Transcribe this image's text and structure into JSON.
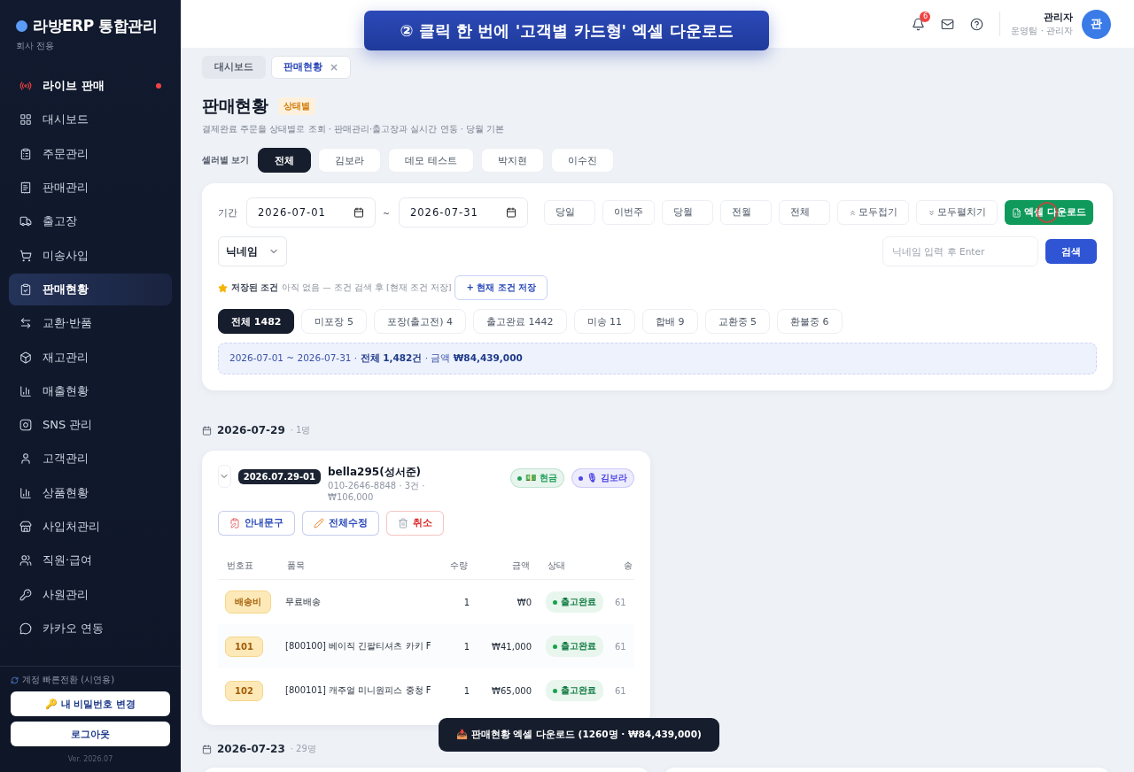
{
  "brand": {
    "title": "라방ERP 통합관리",
    "subtitle": "회사 전용"
  },
  "sidebar": {
    "items": [
      {
        "label": "라이브 판매",
        "selected": false,
        "live": true
      },
      {
        "label": "대시보드",
        "selected": false,
        "live": false
      },
      {
        "label": "주문관리",
        "selected": false,
        "live": false
      },
      {
        "label": "판매관리",
        "selected": false,
        "live": false
      },
      {
        "label": "출고장",
        "selected": false,
        "live": false
      },
      {
        "label": "미송사입",
        "selected": false,
        "live": false
      },
      {
        "label": "판매현황",
        "selected": true,
        "live": false
      },
      {
        "label": "교환·반품",
        "selected": false,
        "live": false
      },
      {
        "label": "재고관리",
        "selected": false,
        "live": false
      },
      {
        "label": "매출현황",
        "selected": false,
        "live": false
      },
      {
        "label": "SNS 관리",
        "selected": false,
        "live": false
      },
      {
        "label": "고객관리",
        "selected": false,
        "live": false
      },
      {
        "label": "상품현황",
        "selected": false,
        "live": false
      },
      {
        "label": "사입처관리",
        "selected": false,
        "live": false
      },
      {
        "label": "직원·급여",
        "selected": false,
        "live": false
      },
      {
        "label": "사원관리",
        "selected": false,
        "live": false
      },
      {
        "label": "카카오 연동",
        "selected": false,
        "live": false
      }
    ],
    "switch_note": "계정 빠른전환 (시연용)",
    "buttons": [
      "🔑 내 비밀번호 변경",
      "로그아웃"
    ],
    "version": "Ver. 2026.07"
  },
  "banner": "② 클릭 한 번에 '고객별 카드형' 엑셀 다운로드",
  "header": {
    "notifications": "6",
    "user_name": "관리자",
    "user_role": "운영팀 · 관리자",
    "avatar": "관"
  },
  "page_tabs": [
    {
      "label": "대시보드",
      "selected": false,
      "closable": false
    },
    {
      "label": "판매현황",
      "selected": true,
      "closable": true
    }
  ],
  "close_mark": "×",
  "page": {
    "title": "판매현황",
    "badge": "상태별",
    "description": "결제완료 주문을 상태별로 조회 · 판매관리·출고장과 실시간 연동 · 당월 기본"
  },
  "seller_filter": {
    "label": "셀러별 보기",
    "options": [
      {
        "label": "전체",
        "selected": true
      },
      {
        "label": "김보라",
        "selected": false
      },
      {
        "label": "데모 테스트",
        "selected": false
      },
      {
        "label": "박지현",
        "selected": false
      },
      {
        "label": "이수진",
        "selected": false
      }
    ]
  },
  "filters": {
    "period_label": "기간",
    "from": "2026-07-01",
    "to": "2026-07-31",
    "tilde": "~",
    "quick": [
      "당일",
      "이번주",
      "당월",
      "전월",
      "전체"
    ],
    "collapse": "모두접기",
    "expand": "모두펼치기",
    "excel": "엑셀 다운로드",
    "search_type": "닉네임",
    "search_placeholder": "닉네임 입력 후 Enter",
    "search_button": "검색",
    "saved_label": "저장된 조건",
    "saved_note": "아직 없음 — 조건 검색 후 [현재 조건 저장]",
    "save_button": "+ 현재 조건 저장",
    "status_tabs": [
      {
        "label": "전체 1482",
        "selected": true
      },
      {
        "label": "미포장 5",
        "selected": false
      },
      {
        "label": "포장(출고전) 4",
        "selected": false
      },
      {
        "label": "출고완료 1442",
        "selected": false
      },
      {
        "label": "미송 11",
        "selected": false
      },
      {
        "label": "합배 9",
        "selected": false
      },
      {
        "label": "교환중 5",
        "selected": false
      },
      {
        "label": "환불중 6",
        "selected": false
      }
    ],
    "summary": "2026-07-01 ~ 2026-07-31 · **전체 1,482건** · 금액 **₩84,439,000**"
  },
  "groups": [
    {
      "date": "2026-07-29",
      "count": "· 1명",
      "orders": [
        {
          "code": "2026.07.29-01",
          "customer": "bella295(성서준)",
          "meta": "010-2646-8848 · 3건 ·",
          "total": "₩106,000",
          "tags": [
            {
              "label": "💵 현금",
              "color": "#22a05a"
            },
            {
              "label": "🎙 김보라",
              "color": "#4f46e5"
            }
          ],
          "actions": [
            {
              "label": "안내문구",
              "kind": "note"
            },
            {
              "label": "전체수정",
              "kind": "edit"
            },
            {
              "label": "취소",
              "kind": "cancel"
            }
          ],
          "columns": [
            "번호표",
            "품목",
            "수량",
            "금액",
            "상태",
            "송"
          ],
          "rows": [
            {
              "ticket": "배송비",
              "item": "무료배송",
              "qty": "1",
              "amount": "₩0",
              "status": "출고완료",
              "column_6": "61"
            },
            {
              "ticket": "101",
              "item": "[800100] 베이직 긴팔티셔츠 카키 F",
              "qty": "1",
              "amount": "₩41,000",
              "status": "출고완료",
              "column_6": "61"
            },
            {
              "ticket": "102",
              "item": "[800101] 캐주얼 미니원피스 중청 F",
              "qty": "1",
              "amount": "₩65,000",
              "status": "출고완료",
              "column_6": "61"
            }
          ]
        }
      ]
    },
    {
      "date": "2026-07-23",
      "count": "· 29명"
    }
  ],
  "toast": "📥 판매현황 엑셀 다운로드 (1260명 · ₩84,439,000)"
}
